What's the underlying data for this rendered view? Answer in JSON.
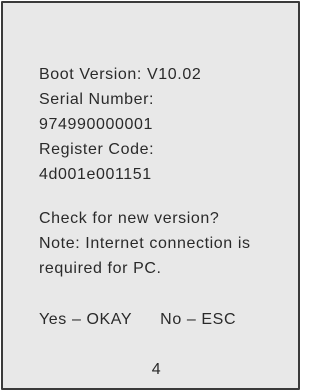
{
  "boot_info": {
    "boot_version": "Boot Version: V10.02",
    "serial_label": "Serial Number:",
    "serial_value": "974990000001",
    "register_label": "Register Code:",
    "register_value": "4d001e001151"
  },
  "prompt": {
    "question": "Check for new version?",
    "note_line1": "Note: Internet connection is",
    "note_line2": "required for PC."
  },
  "options": {
    "yes": "Yes – OKAY",
    "no": "No – ESC"
  },
  "page_number": "4"
}
